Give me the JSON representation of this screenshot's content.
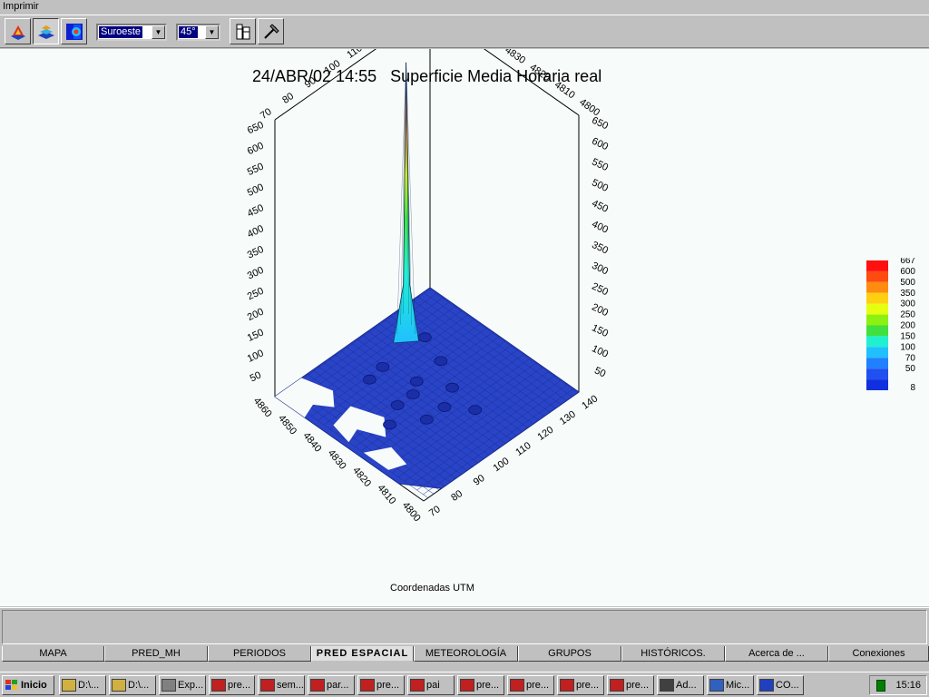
{
  "menubar": {
    "print_label": "Imprimir"
  },
  "toolbar": {
    "view_combo": "Suroeste",
    "angle_combo": "45°",
    "buttons": [
      "surface-3d-icon",
      "layers-3d-icon",
      "color-map-icon",
      "table-icon",
      "tools-icon"
    ]
  },
  "colors": {
    "surface": "#2a44c8",
    "grid": "#1b2f9a",
    "peak_high": "#e02020",
    "plot_bg": "#f7fbfa"
  },
  "chart_data": {
    "type": "surface",
    "title": "24/ABR/02 14:55   Superficie Media Horaria real",
    "xlabel": "Coordenadas UTM",
    "x_axis": {
      "ticks": [
        "70",
        "80",
        "90",
        "100",
        "110",
        "120",
        "130",
        "140"
      ],
      "range": [
        70,
        140
      ]
    },
    "y_axis": {
      "ticks": [
        "4800",
        "4810",
        "4820",
        "4830",
        "4840",
        "4850",
        "4860"
      ],
      "range": [
        4800,
        4860
      ]
    },
    "z_axis": {
      "ticks": [
        "50",
        "100",
        "150",
        "200",
        "250",
        "300",
        "350",
        "400",
        "450",
        "500",
        "550",
        "600",
        "650"
      ],
      "range": [
        0,
        667
      ]
    },
    "peak_value": 667,
    "legend": {
      "placement": "right",
      "labels": [
        "667",
        "600",
        "500",
        "350",
        "300",
        "250",
        "200",
        "150",
        "100",
        "70",
        "50",
        "8"
      ],
      "colors": [
        "#ff1010",
        "#ff4b10",
        "#ff8c10",
        "#ffd010",
        "#e6ff10",
        "#8cf010",
        "#40e040",
        "#20f0d0",
        "#20c0ff",
        "#2080ff",
        "#2050f0",
        "#1030e0"
      ]
    }
  },
  "tabs": [
    {
      "label": "MAPA"
    },
    {
      "label": "PRED_MH"
    },
    {
      "label": "PERIODOS"
    },
    {
      "label": "PRED  ESPACIAL",
      "active": true
    },
    {
      "label": "METEOROLOGÍA"
    },
    {
      "label": "GRUPOS"
    },
    {
      "label": "HISTÓRICOS."
    },
    {
      "label": "Acerca de ..."
    },
    {
      "label": "Conexiones"
    }
  ],
  "taskbar": {
    "start_label": "Inicio",
    "tasks": [
      "D:\\...",
      "D:\\...",
      "Exp...",
      "pre...",
      "sem...",
      "par...",
      "pre...",
      "pai",
      "pre...",
      "pre...",
      "pre...",
      "pre...",
      "Ad...",
      "Mic...",
      "CO..."
    ],
    "clock": "15:16"
  }
}
